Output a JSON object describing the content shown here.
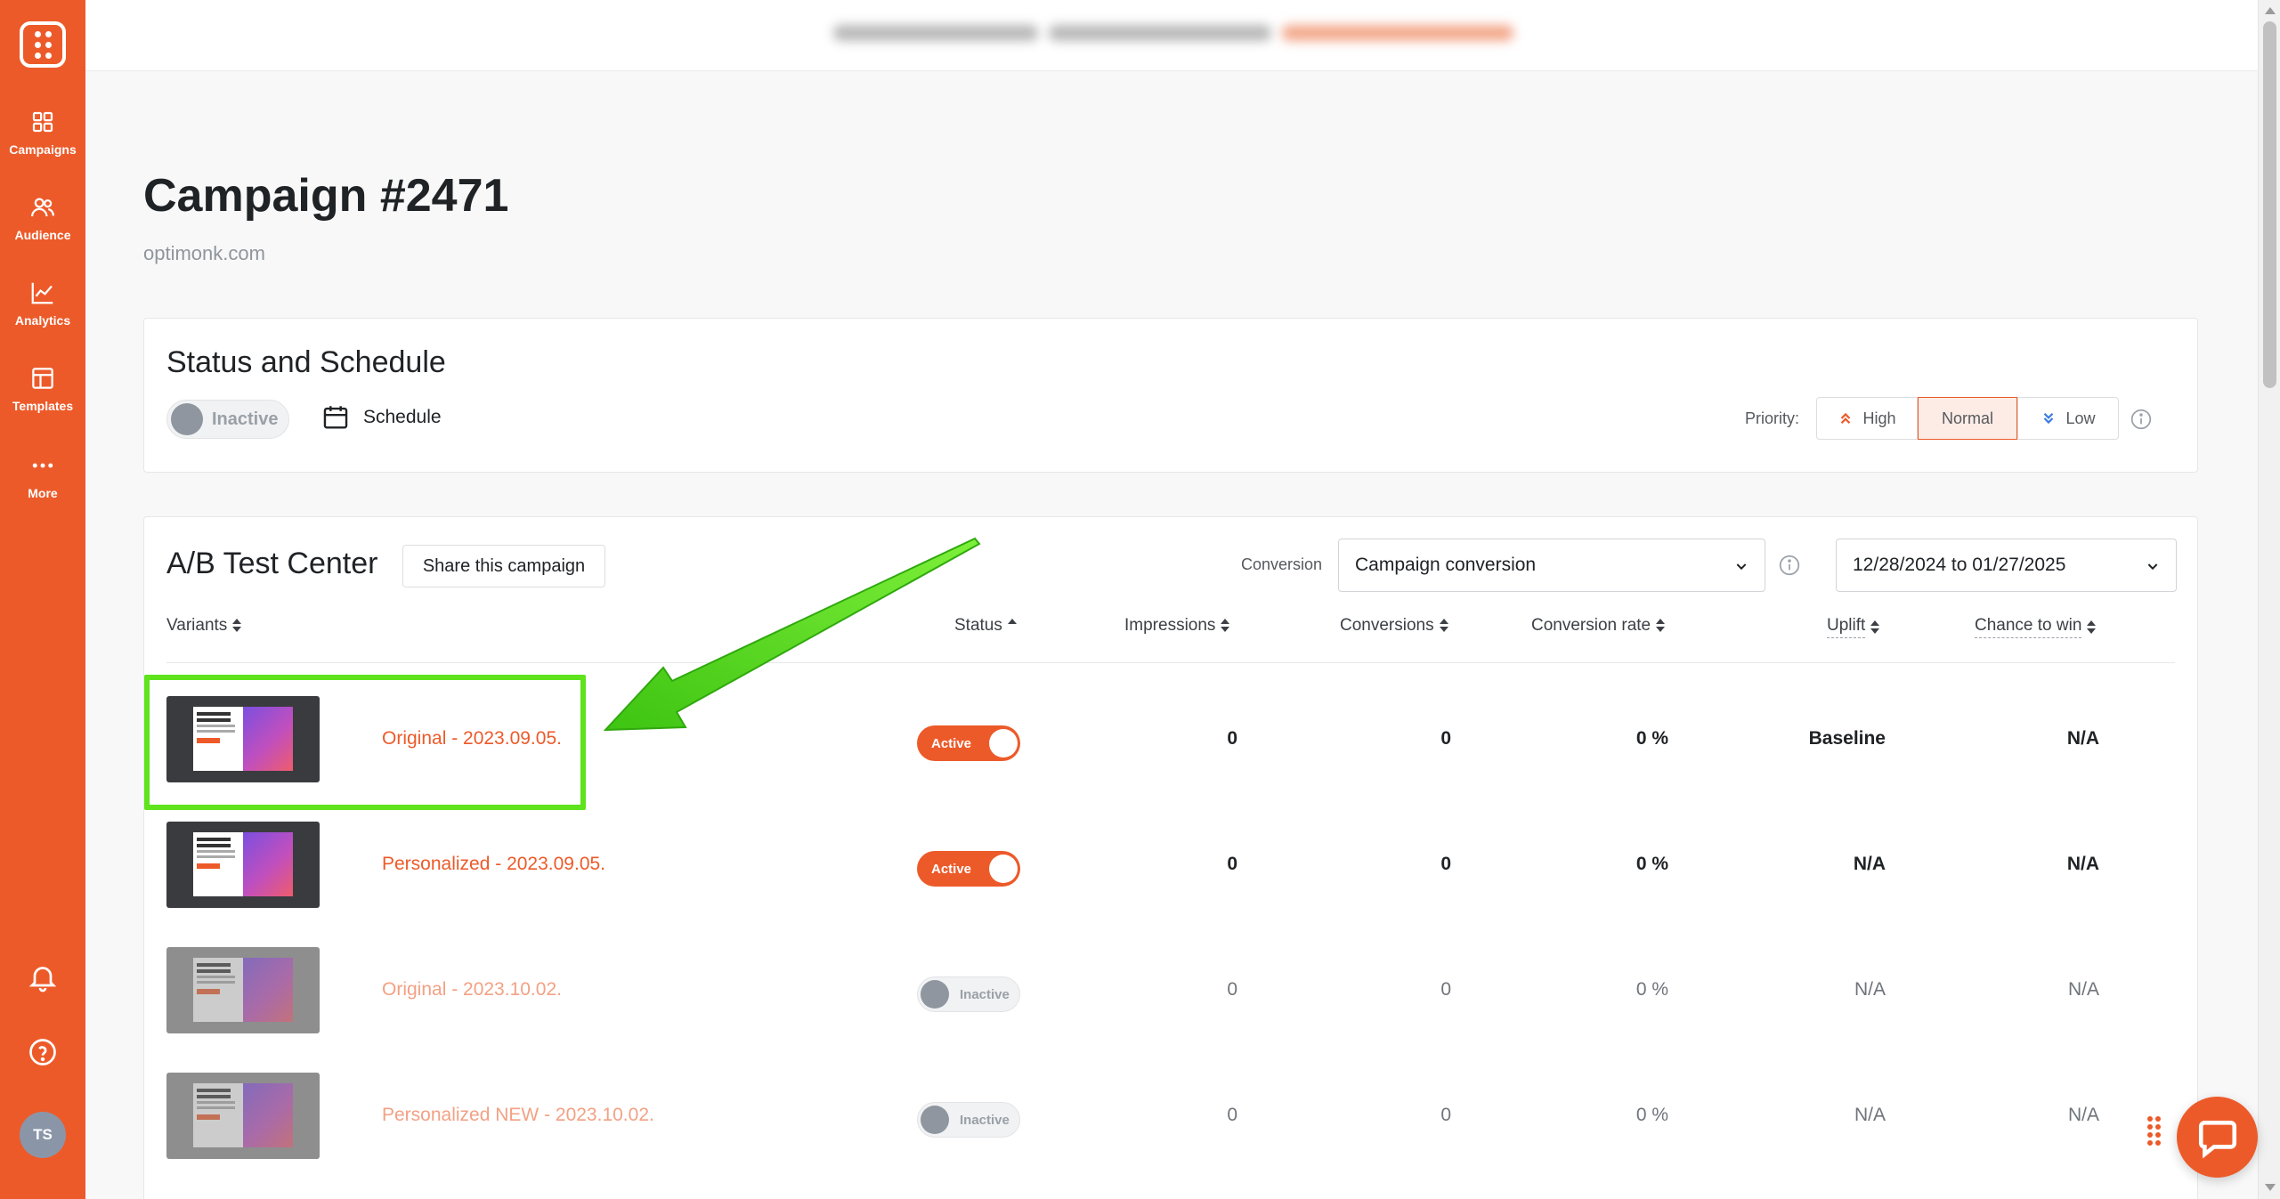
{
  "sidebar": {
    "items": [
      {
        "label": "Campaigns",
        "icon": "grid-icon"
      },
      {
        "label": "Audience",
        "icon": "users-icon"
      },
      {
        "label": "Analytics",
        "icon": "chart-line-icon"
      },
      {
        "label": "Templates",
        "icon": "layout-icon"
      },
      {
        "label": "More",
        "icon": "more-icon"
      }
    ],
    "avatar_initials": "TS"
  },
  "header": {
    "title": "Campaign #2471",
    "domain": "optimonk.com"
  },
  "status_schedule": {
    "title": "Status and Schedule",
    "status_label": "Inactive",
    "schedule_label": "Schedule",
    "priority_label": "Priority:",
    "priority_options": [
      "High",
      "Normal",
      "Low"
    ],
    "priority_selected": "Normal"
  },
  "ab_test": {
    "title": "A/B Test Center",
    "share_label": "Share this campaign",
    "conversion_label": "Conversion",
    "conversion_value": "Campaign conversion",
    "date_range": "12/28/2024 to 01/27/2025",
    "columns": [
      "Variants",
      "Status",
      "Impressions",
      "Conversions",
      "Conversion rate",
      "Uplift",
      "Chance to win"
    ],
    "rows": [
      {
        "name": "Original - 2023.09.05.",
        "status": "Active",
        "impressions": "0",
        "conversions": "0",
        "conversion_rate": "0 %",
        "uplift": "Baseline",
        "chance": "N/A"
      },
      {
        "name": "Personalized - 2023.09.05.",
        "status": "Active",
        "impressions": "0",
        "conversions": "0",
        "conversion_rate": "0 %",
        "uplift": "N/A",
        "chance": "N/A"
      },
      {
        "name": "Original - 2023.10.02.",
        "status": "Inactive",
        "impressions": "0",
        "conversions": "0",
        "conversion_rate": "0 %",
        "uplift": "N/A",
        "chance": "N/A"
      },
      {
        "name": "Personalized NEW - 2023.10.02.",
        "status": "Inactive",
        "impressions": "0",
        "conversions": "0",
        "conversion_rate": "0 %",
        "uplift": "N/A",
        "chance": "N/A"
      }
    ]
  },
  "colors": {
    "brand": "#ed5a29",
    "highlight": "#5ee31c"
  }
}
